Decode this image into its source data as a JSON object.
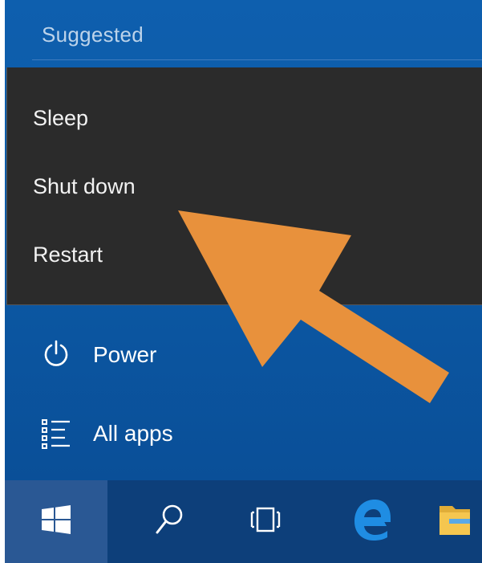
{
  "start_menu": {
    "section_header": "Suggested",
    "power_menu": {
      "items": [
        {
          "label": "Sleep"
        },
        {
          "label": "Shut down"
        },
        {
          "label": "Restart"
        }
      ]
    },
    "list": {
      "power_label": "Power",
      "all_apps_label": "All apps"
    }
  },
  "taskbar": {
    "icons": [
      "windows-logo-icon",
      "search-icon",
      "task-view-icon",
      "edge-browser-icon",
      "file-explorer-icon"
    ]
  },
  "annotation": {
    "icon": "pointer-arrow-icon",
    "color": "#e8913c"
  },
  "colors": {
    "panel_blue": "#0c5aa6",
    "flyout_dark": "#2b2b2b",
    "taskbar_blue": "#0d3f7a",
    "start_button_active": "#2a5894",
    "edge_blue": "#1f8de3",
    "folder_yellow": "#f5c64f"
  }
}
